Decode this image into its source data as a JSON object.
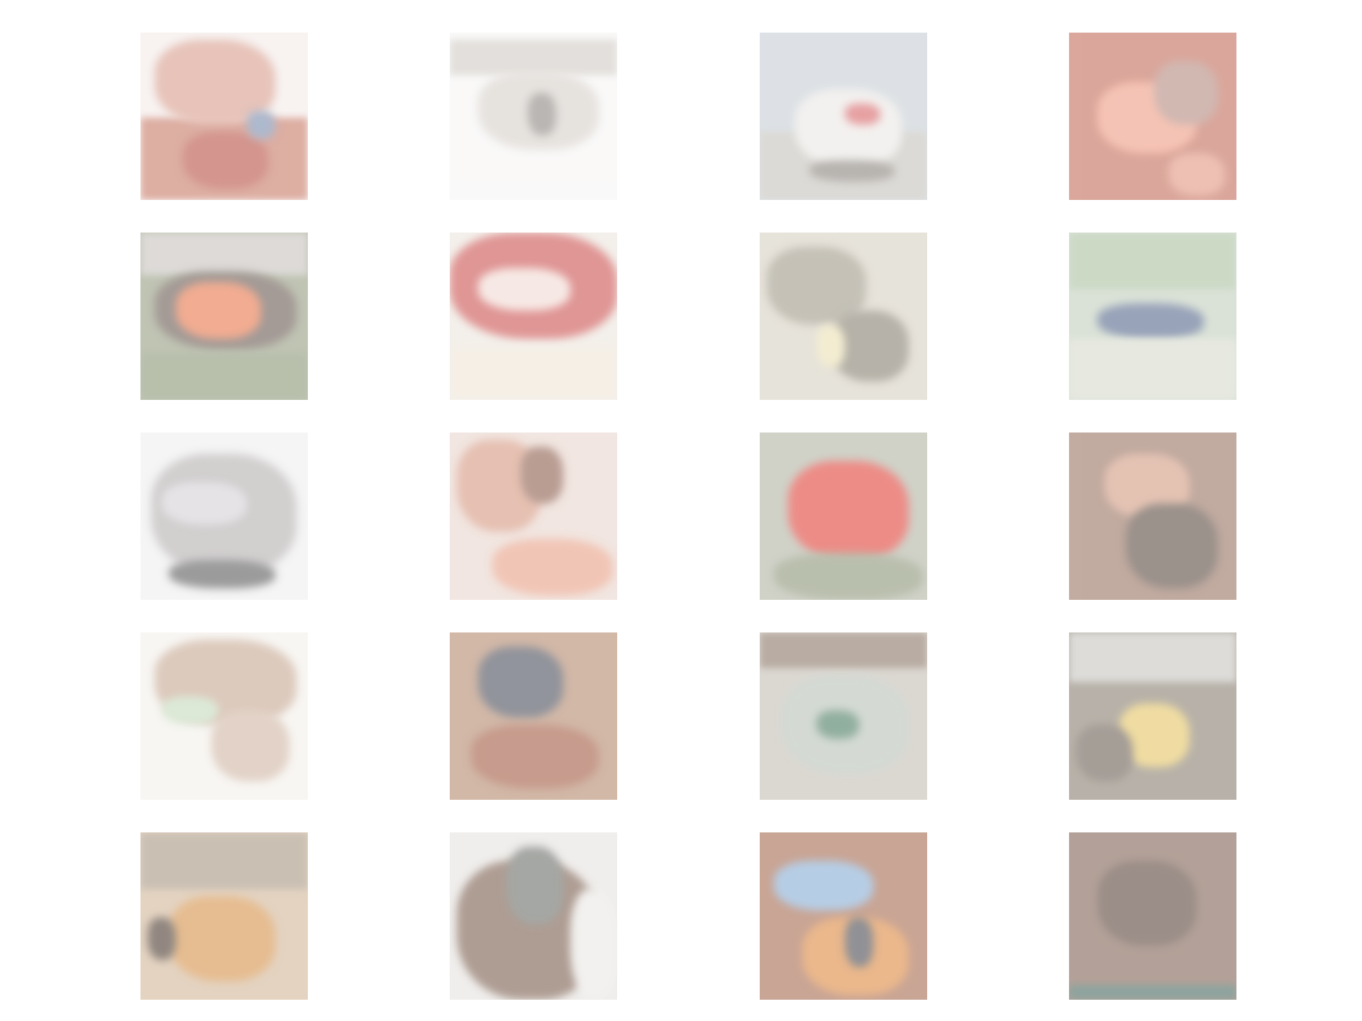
{
  "gallery": {
    "columns": 4,
    "rows": 5,
    "tiles": [
      {
        "id": "tile-1",
        "dominant": "#c77d6b",
        "background": "#f4ecea"
      },
      {
        "id": "tile-2",
        "dominant": "#c9c2bc",
        "background": "#f7f6f5"
      },
      {
        "id": "tile-3",
        "dominant": "#cfcbc4",
        "background": "#bfc9cf"
      },
      {
        "id": "tile-4",
        "dominant": "#c96b5a",
        "background": "#c8806f"
      },
      {
        "id": "tile-5",
        "dominant": "#e47552",
        "background": "#9aa186"
      },
      {
        "id": "tile-6",
        "dominant": "#cc5a55",
        "background": "#ede7df"
      },
      {
        "id": "tile-7",
        "dominant": "#a8a08c",
        "background": "#d8d2c4"
      },
      {
        "id": "tile-8",
        "dominant": "#6d7c93",
        "background": "#c5d1c0"
      },
      {
        "id": "tile-9",
        "dominant": "#9a9a9a",
        "background": "#efefef"
      },
      {
        "id": "tile-10",
        "dominant": "#d58a72",
        "background": "#ead7cf"
      },
      {
        "id": "tile-11",
        "dominant": "#e2453f",
        "background": "#b4b7a7"
      },
      {
        "id": "tile-12",
        "dominant": "#7b5d4d",
        "background": "#a88272"
      },
      {
        "id": "tile-13",
        "dominant": "#c7a48e",
        "background": "#f4f1ec"
      },
      {
        "id": "tile-14",
        "dominant": "#5d6068",
        "background": "#b78d72"
      },
      {
        "id": "tile-15",
        "dominant": "#9bb1a4",
        "background": "#c6c1b6"
      },
      {
        "id": "tile-16",
        "dominant": "#e7c86a",
        "background": "#8d8375"
      },
      {
        "id": "tile-17",
        "dominant": "#d79a55",
        "background": "#d4b99c"
      },
      {
        "id": "tile-18",
        "dominant": "#7a6354",
        "background": "#e7e4e1"
      },
      {
        "id": "tile-19",
        "dominant": "#8ab0d7",
        "background": "#a96f55"
      },
      {
        "id": "tile-20",
        "dominant": "#6f5446",
        "background": "#86695b"
      }
    ]
  }
}
